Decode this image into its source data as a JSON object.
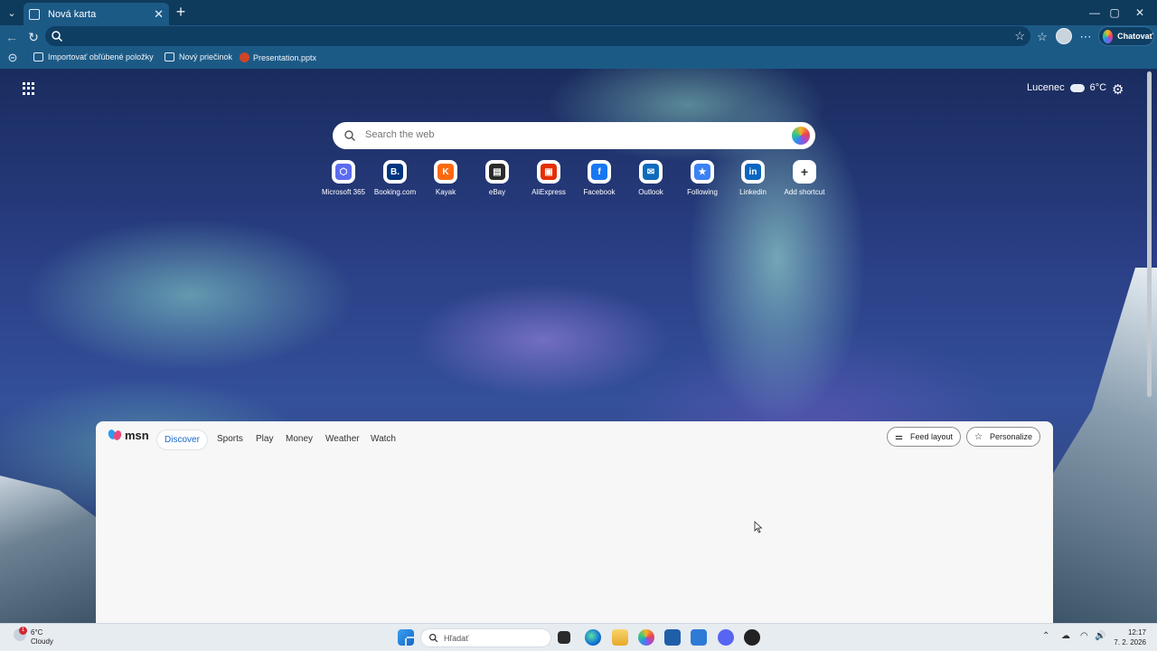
{
  "browser": {
    "tab_title": "Nová karta",
    "address_value": "",
    "chat_label": "Chatovať",
    "favorites": [
      {
        "label": "Importovať obľúbené položky"
      },
      {
        "label": "Nový priečinok"
      },
      {
        "label": "Presentation.pptx"
      }
    ]
  },
  "newtab": {
    "weather": {
      "location": "Lucenec",
      "temperature": "6°C"
    },
    "search_placeholder": "Search the web",
    "shortcuts": [
      {
        "label": "Microsoft 365",
        "color": "#5b6cf0",
        "glyph": "⬡"
      },
      {
        "label": "Booking.com",
        "color": "#003580",
        "glyph": "B."
      },
      {
        "label": "Kayak",
        "color": "#ff690f",
        "glyph": "K"
      },
      {
        "label": "eBay",
        "color": "#2b2b2b",
        "glyph": "▤"
      },
      {
        "label": "AliExpress",
        "color": "#e62e04",
        "glyph": "▣"
      },
      {
        "label": "Facebook",
        "color": "#1877f2",
        "glyph": "f"
      },
      {
        "label": "Outlook",
        "color": "#0f6cbd",
        "glyph": "✉"
      },
      {
        "label": "Following",
        "color": "#3b82f6",
        "glyph": "★"
      },
      {
        "label": "Linkedin",
        "color": "#0a66c2",
        "glyph": "in"
      },
      {
        "label": "Add shortcut",
        "color": "#ffffff",
        "glyph": "+"
      }
    ]
  },
  "feed": {
    "brand": "msn",
    "tabs": [
      "Discover",
      "Sports",
      "Play",
      "Money",
      "Weather",
      "Watch"
    ],
    "active_tab": "Discover",
    "feed_layout_label": "Feed layout",
    "personalize_label": "Personalize"
  },
  "taskbar": {
    "weather_temp": "6°C",
    "weather_desc": "Cloudy",
    "weather_badge": "1",
    "search_label": "Hľadať",
    "time": "12:17",
    "date": "7. 2. 2026"
  }
}
